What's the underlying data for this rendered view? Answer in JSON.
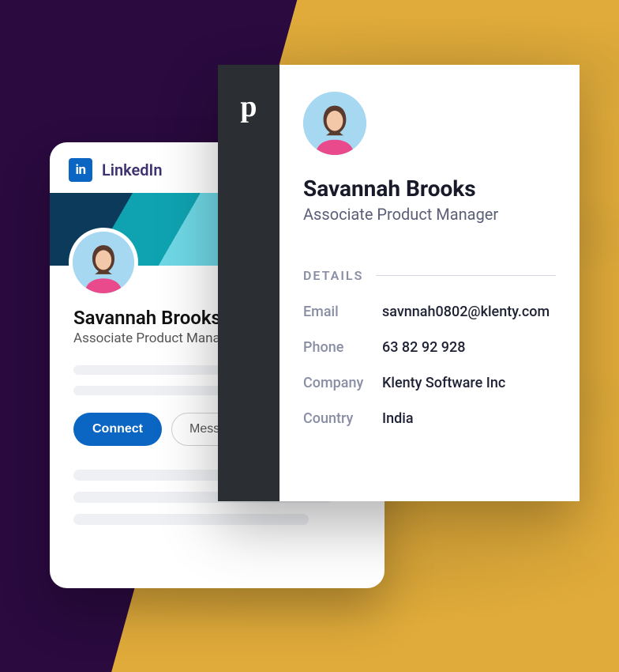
{
  "linkedin": {
    "brand": "LinkedIn",
    "logo_text": "in",
    "name": "Savannah Brooks",
    "title": "Associate Product Manager",
    "connect_label": "Connect",
    "message_label": "Message"
  },
  "crm": {
    "logo_text": "p",
    "name": "Savannah Brooks",
    "title": "Associate Product Manager",
    "details_heading": "DETAILS",
    "rows": {
      "email_label": "Email",
      "email_value": "savnnah0802@klenty.com",
      "phone_label": "Phone",
      "phone_value": "63 82 92 928",
      "company_label": "Company",
      "company_value": "Klenty Software Inc",
      "country_label": "Country",
      "country_value": "India"
    }
  }
}
